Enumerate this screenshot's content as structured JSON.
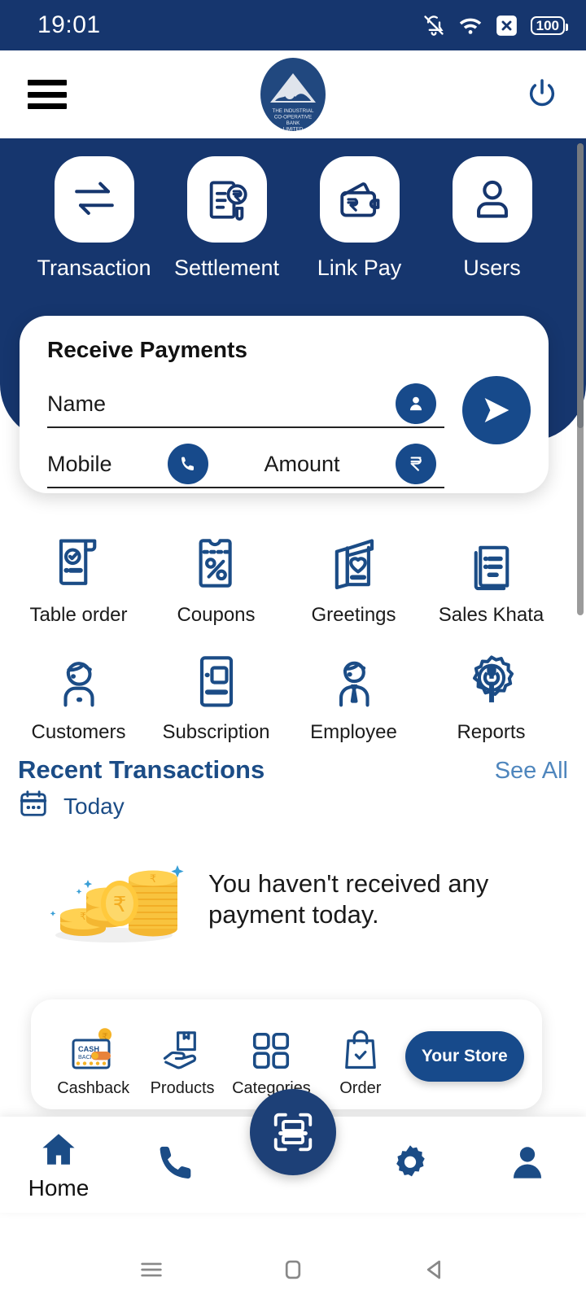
{
  "status_bar": {
    "time": "19:01",
    "battery": "100",
    "icons": [
      "bell-muted-icon",
      "wifi-icon",
      "close-badge-icon",
      "battery-icon"
    ]
  },
  "header": {
    "menu_icon": "hamburger-icon",
    "power_icon": "power-icon",
    "logo": {
      "line1": "THE INDUSTRIAL",
      "line2": "CO-OPERATIVE",
      "line3": "BANK",
      "line4": "LIMITED"
    }
  },
  "quick_actions": [
    {
      "label": "Transaction",
      "icon": "transfer-arrows-icon"
    },
    {
      "label": "Settlement",
      "icon": "invoice-rupee-icon"
    },
    {
      "label": "Link Pay",
      "icon": "wallet-rupee-icon"
    },
    {
      "label": "Users",
      "icon": "user-icon"
    }
  ],
  "receive_payments": {
    "title": "Receive Payments",
    "name_placeholder": "Name",
    "name_value": "",
    "name_icon": "person-icon",
    "mobile_placeholder": "Mobile",
    "mobile_value": "",
    "mobile_icon": "phone-icon",
    "amount_placeholder": "Amount",
    "amount_value": "",
    "amount_icon": "rupee-icon",
    "send_icon": "send-arrow-icon"
  },
  "services": [
    {
      "label": "Table order",
      "icon": "receipt-check-icon"
    },
    {
      "label": "Coupons",
      "icon": "coupon-percent-icon"
    },
    {
      "label": "Greetings",
      "icon": "greeting-card-heart-icon"
    },
    {
      "label": "Sales Khata",
      "icon": "ledger-pages-icon"
    },
    {
      "label": "Customers",
      "icon": "customer-person-icon"
    },
    {
      "label": "Subscription",
      "icon": "subscription-card-icon"
    },
    {
      "label": "Employee",
      "icon": "employee-tie-icon"
    },
    {
      "label": "Reports",
      "icon": "gear-wrench-icon"
    }
  ],
  "recent_transactions": {
    "title": "Recent Transactions",
    "see_all": "See All",
    "date_icon": "calendar-icon",
    "date_label": "Today",
    "empty_message": "You haven't received any payment today.",
    "empty_illustration": "coin-stacks-illustration"
  },
  "store_card": {
    "items": [
      {
        "label": "Cashback",
        "icon": "cashback-card-icon"
      },
      {
        "label": "Products",
        "icon": "hand-box-icon"
      },
      {
        "label": "Categories",
        "icon": "grid-squares-icon"
      },
      {
        "label": "Order",
        "icon": "shopping-bag-check-icon"
      }
    ],
    "button_label": "Your Store"
  },
  "bottom_nav": {
    "items": [
      {
        "label": "Home",
        "icon": "home-icon",
        "active": true
      },
      {
        "label": "",
        "icon": "phone-icon",
        "active": false
      },
      {
        "label": "",
        "icon": "gear-icon",
        "active": false
      },
      {
        "label": "",
        "icon": "profile-icon",
        "active": false
      }
    ],
    "fab_icon": "scan-qr-icon"
  },
  "system_nav": {
    "recents_icon": "recents-icon",
    "home_icon": "home-square-icon",
    "back_icon": "back-triangle-icon"
  },
  "colors": {
    "primary": "#16366e",
    "accent": "#174a8b",
    "link": "#4f86bd",
    "heading": "#1b4c86",
    "surface": "#ffffff"
  }
}
